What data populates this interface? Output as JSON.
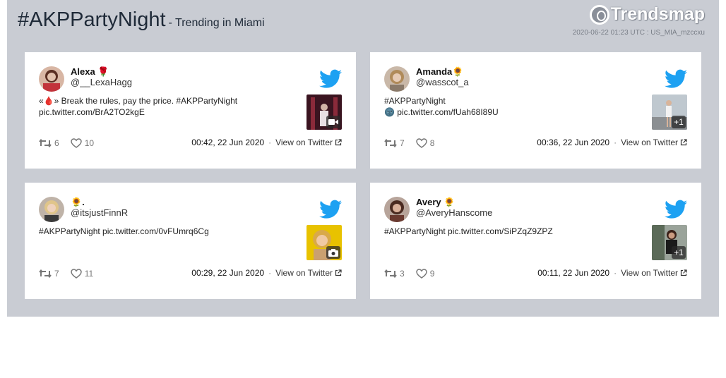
{
  "header": {
    "hashtag": "#AKPPartyNight",
    "subtitle": "- Trending in Miami",
    "brand": "Trendsmap",
    "stamp": "2020-06-22 01:23 UTC : US_MIA_mzccxu"
  },
  "colors": {
    "panel": "#c9ccd3",
    "twitter_blue": "#1da1f2"
  },
  "tweets": [
    {
      "name": "Alexa 🌹",
      "handle": "@__LexaHagg",
      "text": "«🩸» Break the rules, pay the price. #AKPPartyNight pic.twitter.com/BrA2TO2kgE",
      "media_icon": "video-icon",
      "media_badge": "",
      "retweets": "6",
      "likes": "10",
      "time": "00:42, 22 Jun 2020",
      "view_label": "View on Twitter"
    },
    {
      "name": "Amanda🌻",
      "handle": "@wasscot_a",
      "text": "#AKPPartyNight\n🌚 pic.twitter.com/fUah68I89U",
      "media_icon": "",
      "media_badge": "+1",
      "retweets": "7",
      "likes": "8",
      "time": "00:36, 22 Jun 2020",
      "view_label": "View on Twitter"
    },
    {
      "name": "🌻.",
      "handle": "@itsjustFinnR",
      "text": "#AKPPartyNight pic.twitter.com/0vFUmrq6Cg",
      "media_icon": "camera-icon",
      "media_badge": "",
      "retweets": "7",
      "likes": "11",
      "time": "00:29, 22 Jun 2020",
      "view_label": "View on Twitter"
    },
    {
      "name": "Avery 🌻",
      "handle": "@AveryHanscome",
      "text": "#AKPPartyNight pic.twitter.com/SiPZqZ9ZPZ",
      "media_icon": "",
      "media_badge": "+1",
      "retweets": "3",
      "likes": "9",
      "time": "00:11, 22 Jun 2020",
      "view_label": "View on Twitter"
    }
  ]
}
